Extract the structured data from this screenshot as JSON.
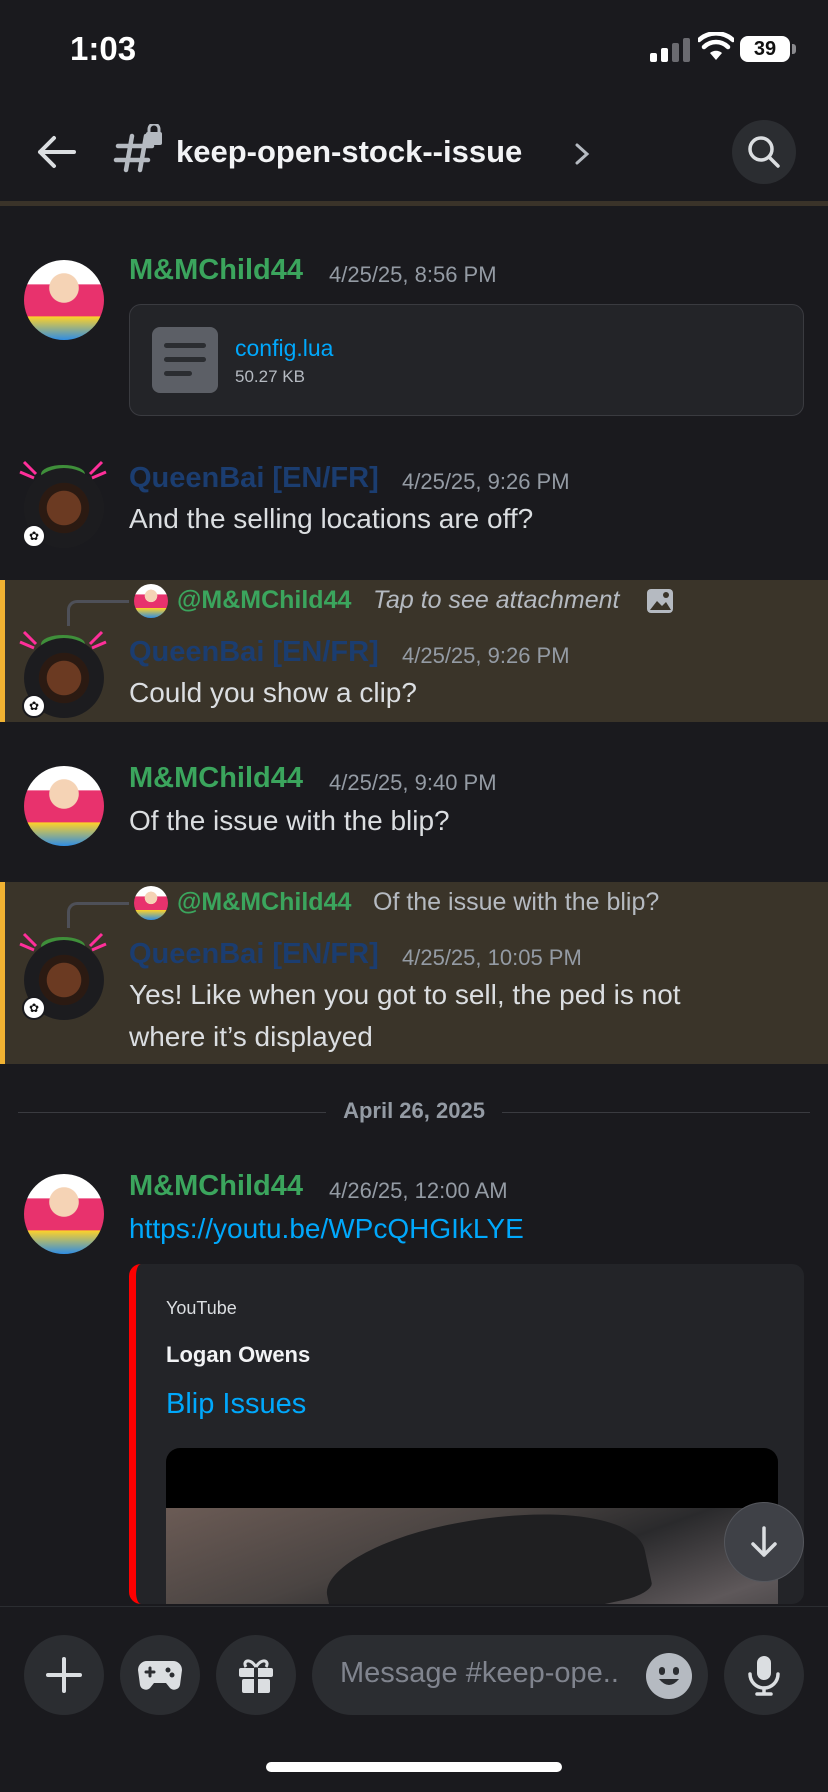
{
  "status_bar": {
    "time": "1:03",
    "battery": "39"
  },
  "header": {
    "channel_name": "keep-open-stock--issue"
  },
  "messages": [
    {
      "author": "M&MChild44",
      "timestamp": "4/25/25, 8:56 PM",
      "attachment": {
        "name": "config.lua",
        "size": "50.27 KB"
      }
    },
    {
      "author": "QueenBai [EN/FR]",
      "timestamp": "4/25/25, 9:26 PM",
      "text": "And the selling locations are off?"
    },
    {
      "reply": {
        "mention": "@M&MChild44",
        "text": "Tap to see attachment"
      },
      "author": "QueenBai [EN/FR]",
      "timestamp": "4/25/25, 9:26 PM",
      "text": "Could you show a clip?"
    },
    {
      "author": "M&MChild44",
      "timestamp": "4/25/25, 9:40 PM",
      "text": "Of the issue with the blip?"
    },
    {
      "reply": {
        "mention": "@M&MChild44",
        "text": "Of the issue with the blip?"
      },
      "author": "QueenBai [EN/FR]",
      "timestamp": "4/25/25, 10:05 PM",
      "text_line1": "Yes! Like when you got to sell, the ped is not",
      "text_line2": "where it’s displayed"
    },
    {
      "author": "M&MChild44",
      "timestamp": "4/26/25, 12:00 AM",
      "link": "https://youtu.be/WPcQHGIkLYE",
      "embed": {
        "provider": "YouTube",
        "author": "Logan Owens",
        "title": "Blip Issues"
      }
    }
  ],
  "date_divider": "April 26, 2025",
  "composer": {
    "placeholder": "Message #keep-ope.."
  },
  "colors": {
    "accent_link": "#00a8fc",
    "username_green": "#3ba55d",
    "highlight_bar": "#f0b232",
    "youtube_red": "#ff0000"
  },
  "icons": [
    "back-arrow-icon",
    "hashtag-lock-icon",
    "chevron-right-icon",
    "search-icon",
    "file-icon",
    "image-icon",
    "arrow-down-icon",
    "plus-icon",
    "gamepad-icon",
    "gift-icon",
    "emoji-icon",
    "microphone-icon"
  ]
}
